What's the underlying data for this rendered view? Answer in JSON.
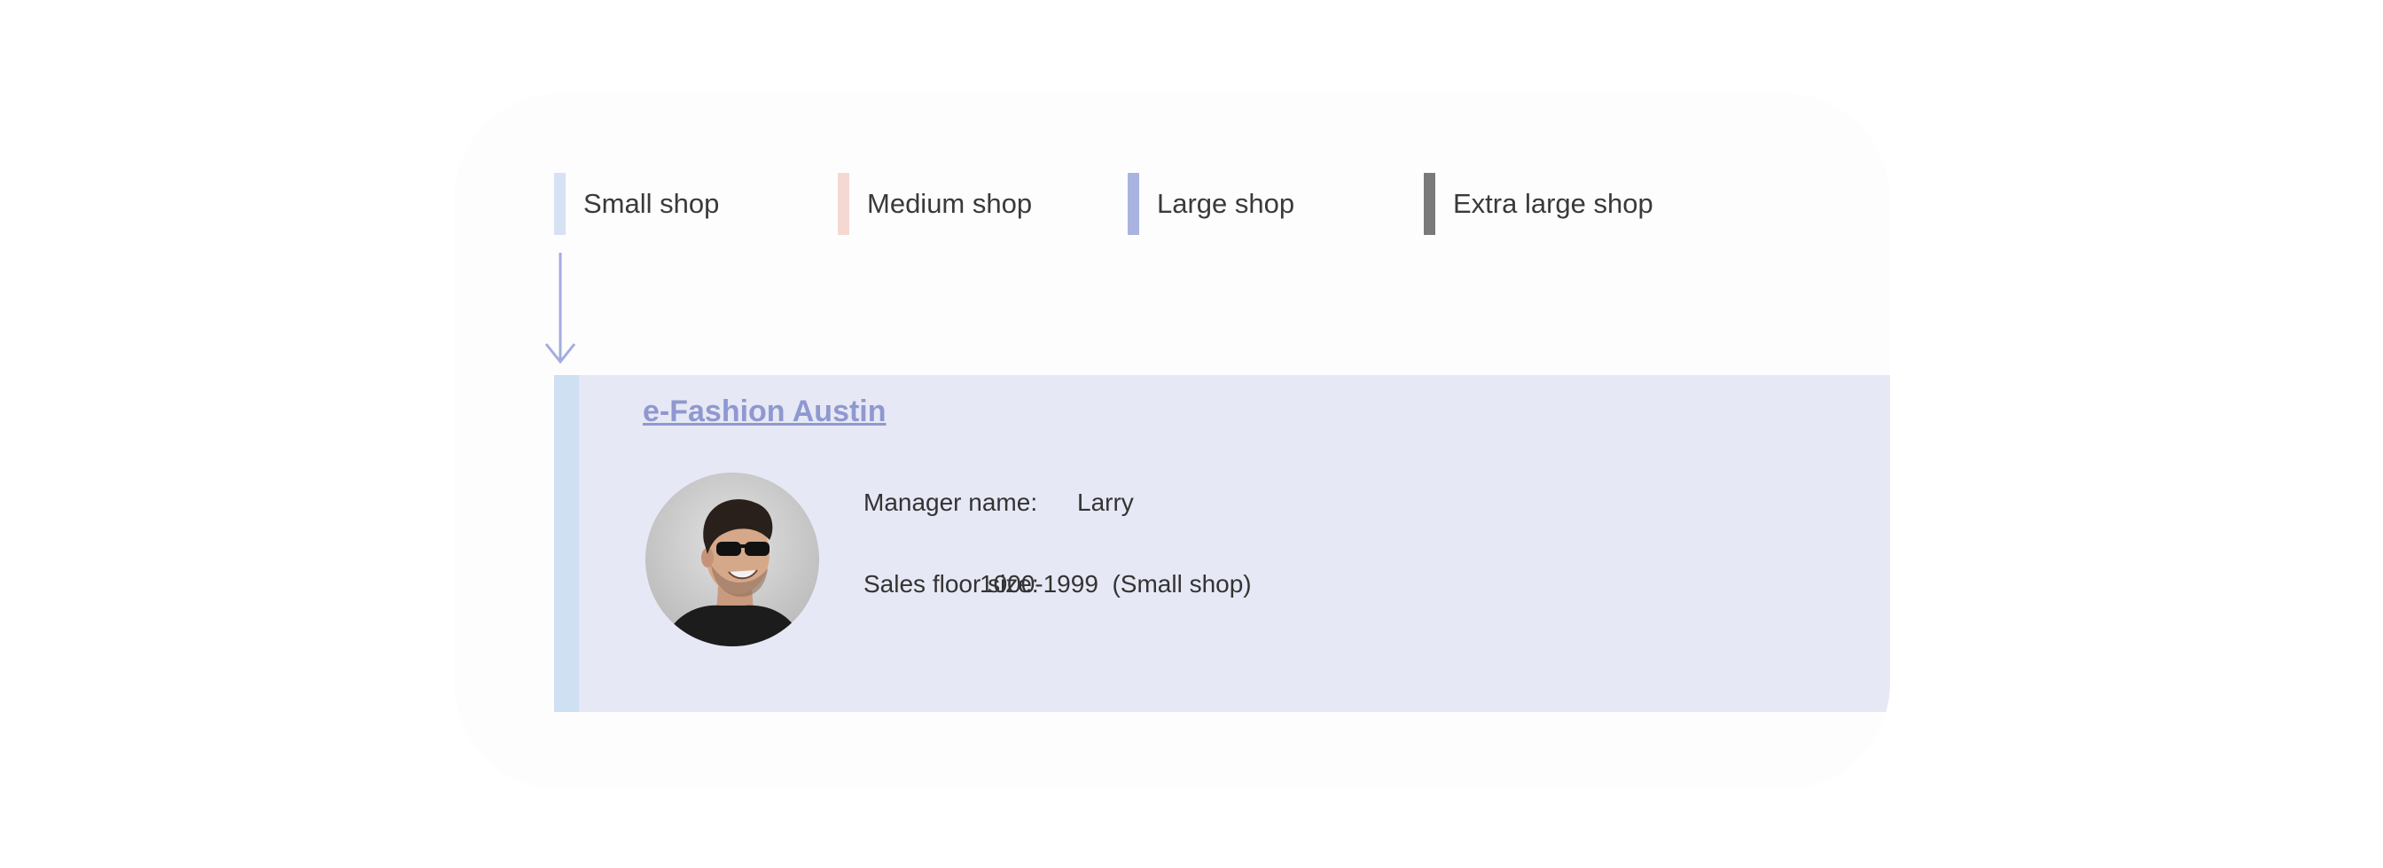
{
  "legend": {
    "items": [
      {
        "label": "Small shop",
        "color": "#d6e2f3"
      },
      {
        "label": "Medium shop",
        "color": "#f6d8d2"
      },
      {
        "label": "Large shop",
        "color": "#a9b3df"
      },
      {
        "label": "Extra large shop",
        "color": "#7a7a7a"
      }
    ]
  },
  "arrow_color": "#a4acdf",
  "card": {
    "title": "e-Fashion Austin",
    "accent_color": "#cfe0f3",
    "background": "#e6e8f5",
    "manager_label": "Manager name:",
    "manager_value": "Larry",
    "size_label": "Sales floor size:",
    "size_value": "1000-1999  (Small shop)"
  }
}
